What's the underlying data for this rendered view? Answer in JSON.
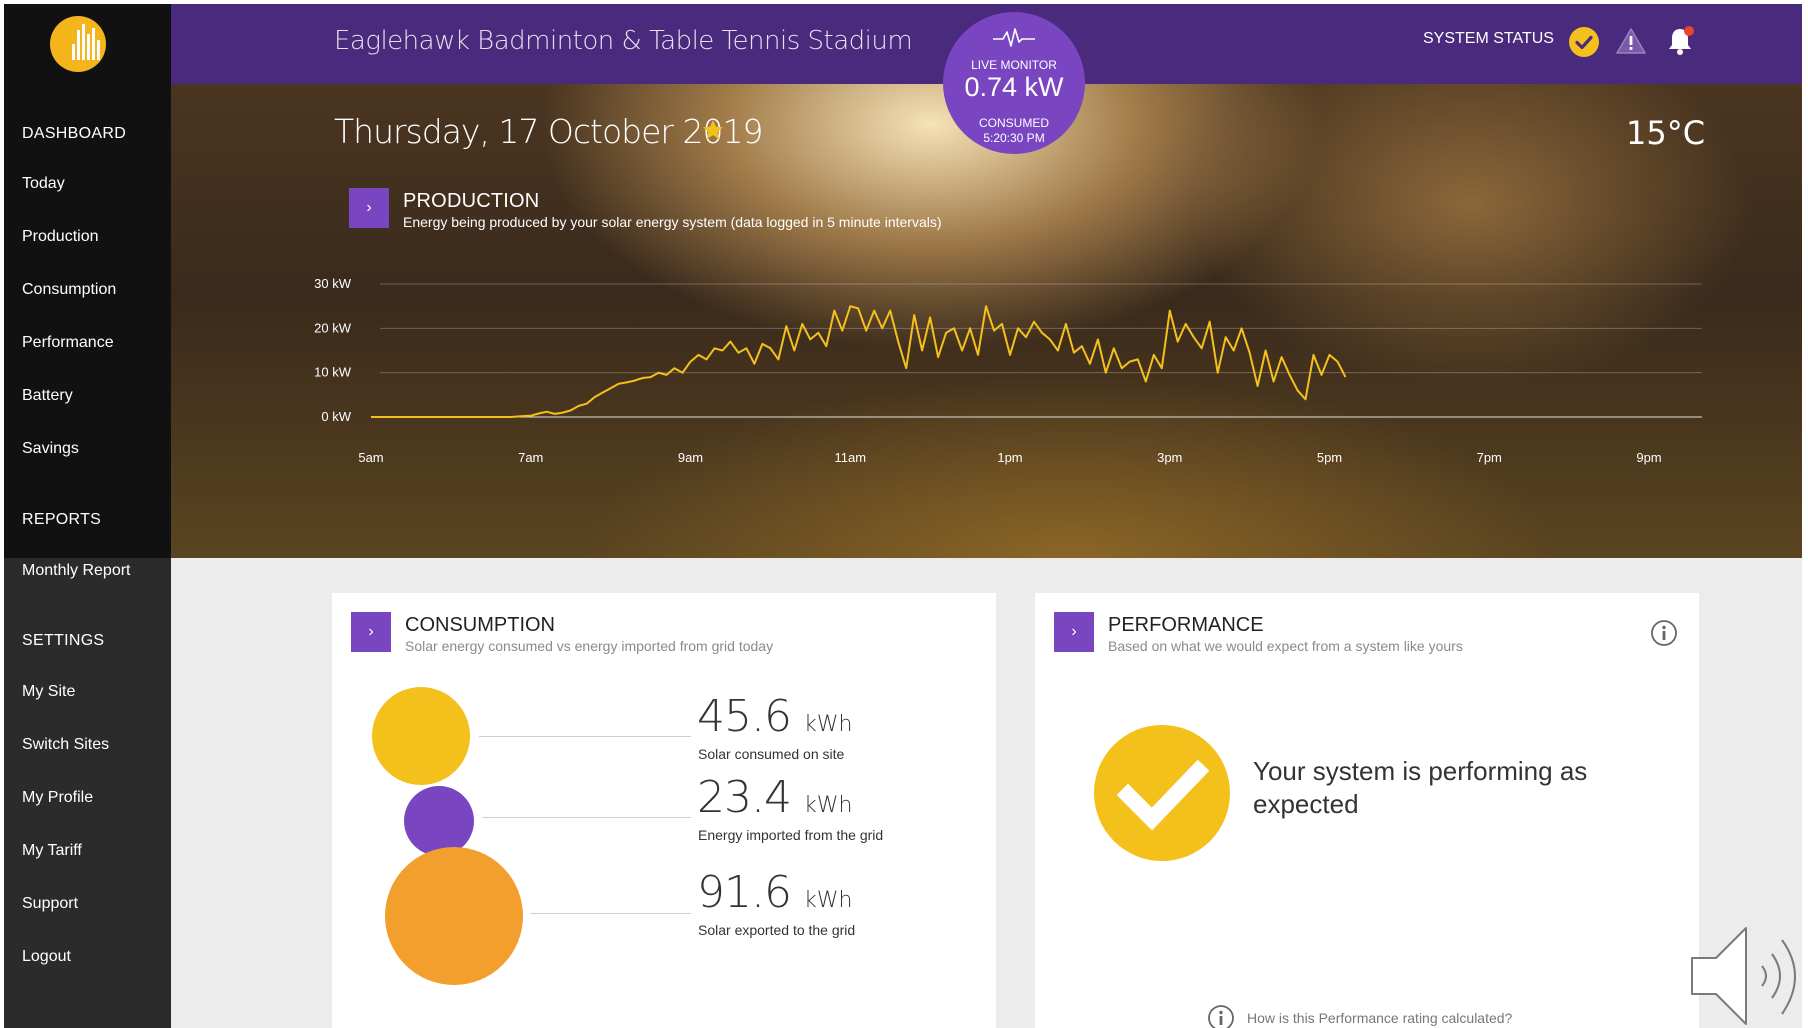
{
  "app": {
    "site_name": "Eaglehawk Badminton & Table Tennis Stadium",
    "brand_color": "#4a2a7c",
    "accent_color": "#7a45c0",
    "solar_color": "#f4c01c"
  },
  "sidebar": {
    "logo_icon": "solar-logo-icon",
    "sections": [
      {
        "title": "DASHBOARD",
        "items": [
          "Today",
          "Production",
          "Consumption",
          "Performance",
          "Battery",
          "Savings"
        ]
      },
      {
        "title": "REPORTS",
        "items": [
          "Monthly Report"
        ]
      },
      {
        "title": "SETTINGS",
        "items": [
          "My Site",
          "Switch Sites",
          "My Profile",
          "My Tariff",
          "Support",
          "Logout"
        ]
      }
    ]
  },
  "header": {
    "system_status_label": "SYSTEM STATUS",
    "status_icons": [
      "check-circle-icon",
      "warning-icon",
      "bell-icon"
    ]
  },
  "live_monitor": {
    "label": "LIVE MONITOR",
    "value": "0.74 kW",
    "status": "CONSUMED",
    "time": "5:20:30 PM"
  },
  "hero": {
    "date": "Thursday, 17 October 2019",
    "temperature": "15°C"
  },
  "production": {
    "title": "PRODUCTION",
    "subtitle": "Energy being produced by your solar energy system (data logged in 5 minute intervals)",
    "expand_label": "›"
  },
  "chart_data": {
    "type": "line",
    "title": "",
    "xlabel": "",
    "ylabel": "",
    "color": "#f4c01c",
    "grid": true,
    "ylim": [
      0,
      30
    ],
    "y_ticks": [
      0,
      10,
      20,
      30
    ],
    "y_tick_labels": [
      "0 kW",
      "10 kW",
      "20 kW",
      "30 kW"
    ],
    "xlim": [
      5,
      21
    ],
    "x_ticks": [
      5,
      7,
      9,
      11,
      13,
      15,
      17,
      19,
      21
    ],
    "x_tick_labels": [
      "5am",
      "7am",
      "9am",
      "11am",
      "1pm",
      "3pm",
      "5pm",
      "7pm",
      "9pm"
    ],
    "x_hours": [
      5.0,
      5.5,
      6.0,
      6.5,
      6.75,
      6.9,
      7.0,
      7.1,
      7.2,
      7.3,
      7.4,
      7.5,
      7.6,
      7.7,
      7.8,
      7.9,
      8.0,
      8.1,
      8.2,
      8.3,
      8.4,
      8.5,
      8.6,
      8.7,
      8.8,
      8.9,
      9.0,
      9.1,
      9.2,
      9.3,
      9.4,
      9.5,
      9.6,
      9.7,
      9.8,
      9.9,
      10.0,
      10.1,
      10.2,
      10.3,
      10.4,
      10.5,
      10.6,
      10.7,
      10.8,
      10.9,
      11.0,
      11.1,
      11.2,
      11.3,
      11.4,
      11.5,
      11.6,
      11.7,
      11.8,
      11.9,
      12.0,
      12.1,
      12.2,
      12.3,
      12.4,
      12.5,
      12.6,
      12.7,
      12.8,
      12.9,
      13.0,
      13.1,
      13.2,
      13.3,
      13.4,
      13.5,
      13.6,
      13.7,
      13.8,
      13.9,
      14.0,
      14.1,
      14.2,
      14.3,
      14.4,
      14.5,
      14.6,
      14.7,
      14.8,
      14.9,
      15.0,
      15.1,
      15.2,
      15.3,
      15.4,
      15.5,
      15.6,
      15.7,
      15.8,
      15.9,
      16.0,
      16.1,
      16.2,
      16.3,
      16.4,
      16.5,
      16.6,
      16.7,
      16.8,
      16.9,
      17.0,
      17.1,
      17.2
    ],
    "y_kw": [
      0,
      0,
      0,
      0,
      0,
      0.2,
      0.3,
      0.8,
      1.2,
      0.7,
      1.0,
      1.5,
      2.5,
      3.0,
      4.5,
      5.5,
      6.5,
      7.5,
      7.8,
      8.2,
      8.8,
      9.0,
      10.0,
      9.5,
      11.0,
      10.0,
      12.5,
      14.0,
      13.0,
      15.5,
      15.0,
      17.0,
      14.5,
      15.5,
      12.0,
      16.5,
      15.5,
      13.0,
      20.5,
      15.0,
      21.0,
      17.5,
      19.0,
      16.0,
      24.0,
      19.5,
      25.0,
      24.5,
      19.5,
      24.0,
      20.0,
      24.0,
      17.0,
      11.0,
      23.0,
      15.0,
      22.5,
      13.5,
      19.0,
      20.0,
      15.0,
      20.0,
      14.0,
      25.0,
      19.5,
      21.0,
      14.0,
      20.0,
      18.0,
      21.5,
      19.0,
      17.5,
      15.0,
      21.0,
      14.5,
      16.0,
      12.0,
      17.5,
      10.0,
      15.5,
      11.0,
      12.5,
      13.0,
      8.0,
      14.0,
      11.0,
      24.0,
      17.0,
      21.0,
      18.0,
      15.5,
      21.5,
      10.0,
      18.0,
      15.0,
      20.0,
      14.5,
      7.0,
      15.0,
      8.0,
      13.5,
      9.5,
      6.0,
      4.0,
      14.0,
      9.5,
      14.0,
      12.5,
      9.0
    ]
  },
  "consumption": {
    "title": "CONSUMPTION",
    "subtitle": "Solar energy consumed vs energy imported from grid today",
    "expand_label": "›",
    "metrics": [
      {
        "value": "45.6",
        "unit": "kWh",
        "label": "Solar consumed on site",
        "color": "#f4c01c"
      },
      {
        "value": "23.4",
        "unit": "kWh",
        "label": "Energy imported from the grid",
        "color": "#7a45c0"
      },
      {
        "value": "91.6",
        "unit": "kWh",
        "label": "Solar exported to the grid",
        "color": "#f29f2e"
      }
    ]
  },
  "performance": {
    "title": "PERFORMANCE",
    "subtitle": "Based on what we would expect from a system like yours",
    "expand_label": "›",
    "message": "Your system is performing as expected",
    "footer_link": "How is this Performance rating calculated?"
  }
}
